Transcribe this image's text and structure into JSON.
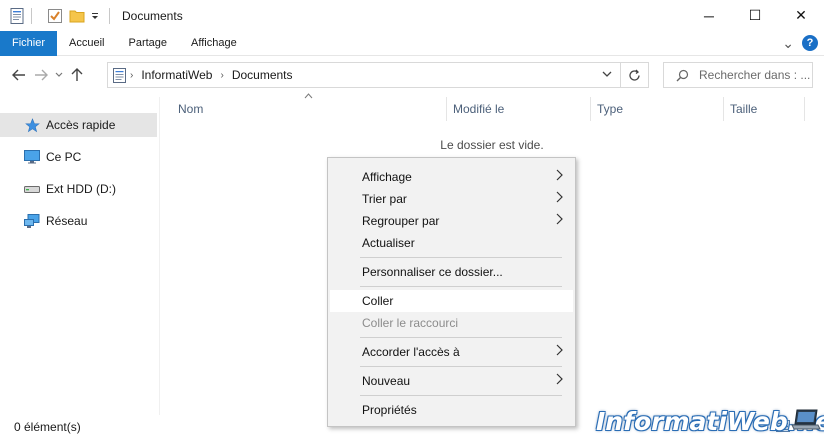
{
  "window": {
    "title": "Documents",
    "controls": {
      "minimize": "─",
      "maximize": "☐",
      "close": "✕"
    }
  },
  "ribbon": {
    "tabs": [
      "Fichier",
      "Accueil",
      "Partage",
      "Affichage"
    ],
    "expand_glyph": "⌄",
    "help_glyph": "?"
  },
  "address": {
    "breadcrumb": [
      "InformatiWeb",
      "Documents"
    ],
    "search_placeholder": "Rechercher dans : ..."
  },
  "sidebar": {
    "items": [
      {
        "label": "Accès rapide",
        "icon": "star-icon",
        "selected": true
      },
      {
        "label": "Ce PC",
        "icon": "monitor-icon",
        "selected": false
      },
      {
        "label": "Ext HDD (D:)",
        "icon": "drive-icon",
        "selected": false
      },
      {
        "label": "Réseau",
        "icon": "network-icon",
        "selected": false
      }
    ]
  },
  "columns": [
    "Nom",
    "Modifié le",
    "Type",
    "Taille"
  ],
  "content": {
    "empty_message": "Le dossier est vide."
  },
  "statusbar": {
    "count": "0 élément(s)"
  },
  "context_menu": {
    "items": [
      {
        "label": "Affichage",
        "submenu": true
      },
      {
        "label": "Trier par",
        "submenu": true
      },
      {
        "label": "Regrouper par",
        "submenu": true
      },
      {
        "label": "Actualiser",
        "submenu": false
      },
      {
        "label": "Personnaliser ce dossier...",
        "submenu": false
      },
      {
        "label": "Coller",
        "submenu": false,
        "highlighted": true
      },
      {
        "label": "Coller le raccourci",
        "submenu": false,
        "disabled": true
      },
      {
        "label": "Accorder l'accès à",
        "submenu": true
      },
      {
        "label": "Nouveau",
        "submenu": true
      },
      {
        "label": "Propriétés",
        "submenu": false
      }
    ]
  },
  "watermark": "InformatiWeb.net",
  "colors": {
    "file_tab": "#1979ca",
    "selected_sidebar": "#e5e5e5",
    "menu_bg": "#f2f2f2",
    "header_text": "#4c607a"
  }
}
